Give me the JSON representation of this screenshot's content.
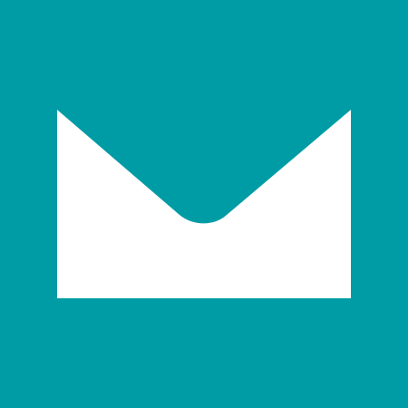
{
  "tile": {
    "icon": "mail-envelope-icon",
    "background_color": "#009ca6",
    "icon_color": "#ffffff"
  }
}
